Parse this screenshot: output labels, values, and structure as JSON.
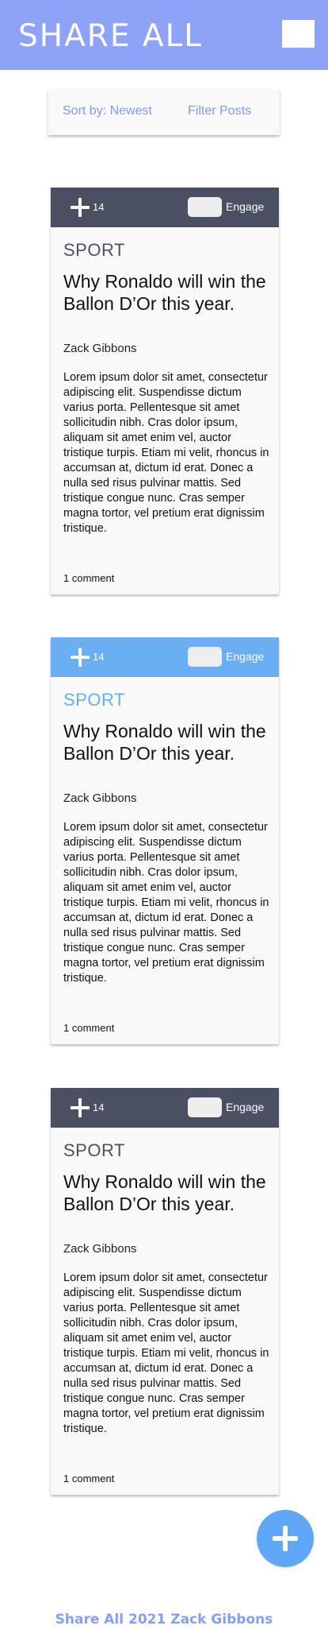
{
  "header": {
    "title": "SHARE ALL",
    "menu_icon": "menu-icon"
  },
  "sortbar": {
    "sort_label": "Sort by: Newest",
    "filter_label": "Filter Posts"
  },
  "posts": [
    {
      "plus_count": "14",
      "engage_label": "Engage",
      "category": "SPORT",
      "title": "Why Ronaldo will win the Ballon D’Or this year.",
      "author": "Zack Gibbons",
      "excerpt": "Lorem ipsum dolor sit amet, consectetur adipiscing elit. Suspendisse dictum varius porta. Pellentesque sit amet sollicitudin nibh. Cras dolor ipsum, aliquam sit amet enim vel, auctor tristique turpis. Etiam mi velit, rhoncus in accumsan at, dictum id erat. Donec a nulla sed risus pulvinar mattis. Sed tristique congue nunc. Cras semper magna tortor, vel pretium erat dignissim tristique.",
      "comments": "1 comment",
      "bar_color": "#4a4f61"
    },
    {
      "plus_count": "14",
      "engage_label": "Engage",
      "category": "SPORT",
      "title": "Why Ronaldo will win the Ballon D’Or this year.",
      "author": "Zack Gibbons",
      "excerpt": "Lorem ipsum dolor sit amet, consectetur adipiscing elit. Suspendisse dictum varius porta. Pellentesque sit amet sollicitudin nibh. Cras dolor ipsum, aliquam sit amet enim vel, auctor tristique turpis. Etiam mi velit, rhoncus in accumsan at, dictum id erat. Donec a nulla sed risus pulvinar mattis. Sed tristique congue nunc. Cras semper magna tortor, vel pretium erat dignissim tristique.",
      "comments": "1 comment",
      "bar_color": "#6aaef4"
    },
    {
      "plus_count": "14",
      "engage_label": "Engage",
      "category": "SPORT",
      "title": "Why Ronaldo will win the Ballon D’Or this year.",
      "author": "Zack Gibbons",
      "excerpt": "Lorem ipsum dolor sit amet, consectetur adipiscing elit. Suspendisse dictum varius porta. Pellentesque sit amet sollicitudin nibh. Cras dolor ipsum, aliquam sit amet enim vel, auctor tristique turpis. Etiam mi velit, rhoncus in accumsan at, dictum id erat. Donec a nulla sed risus pulvinar mattis. Sed tristique congue nunc. Cras semper magna tortor, vel pretium erat dignissim tristique.",
      "comments": "1 comment",
      "bar_color": "#4a4f61"
    }
  ],
  "fab": {
    "icon": "plus-icon"
  },
  "footer": {
    "text": "Share All 2021 Zack Gibbons"
  },
  "colors": {
    "header": "#8ea3f7",
    "accent_blue": "#6aaef4",
    "dark_bar": "#4a4f61",
    "link": "#7f9bf0"
  }
}
